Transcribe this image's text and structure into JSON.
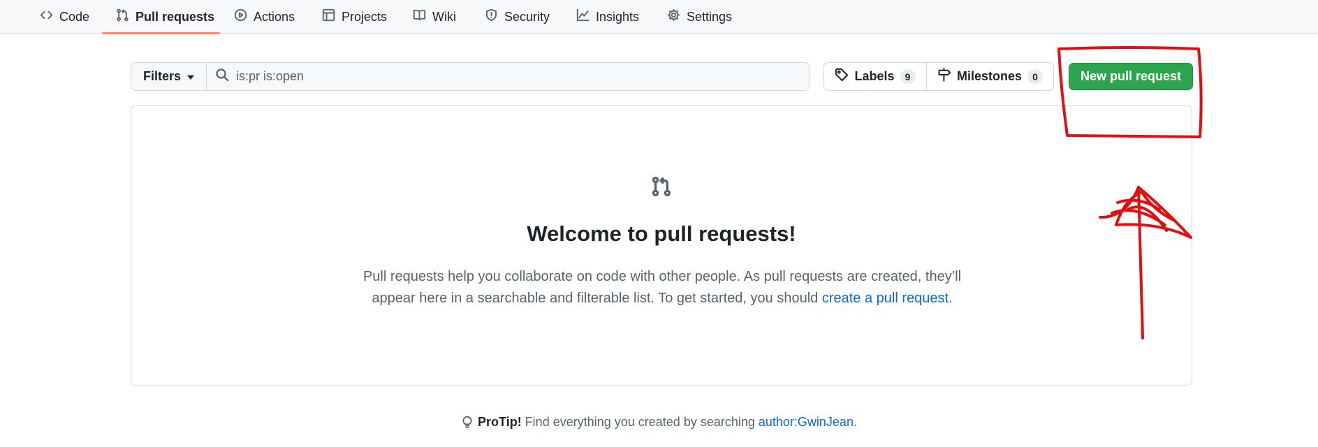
{
  "nav": {
    "items": [
      {
        "label": "Code",
        "icon": "code-icon"
      },
      {
        "label": "Pull requests",
        "icon": "git-pull-request-icon",
        "selected": true
      },
      {
        "label": "Actions",
        "icon": "play-circle-icon"
      },
      {
        "label": "Projects",
        "icon": "table-icon"
      },
      {
        "label": "Wiki",
        "icon": "book-icon"
      },
      {
        "label": "Security",
        "icon": "shield-icon"
      },
      {
        "label": "Insights",
        "icon": "graph-icon"
      },
      {
        "label": "Settings",
        "icon": "gear-icon"
      }
    ]
  },
  "toolbar": {
    "filters_label": "Filters",
    "search_value": "is:pr is:open",
    "labels_label": "Labels",
    "labels_count": "9",
    "milestones_label": "Milestones",
    "milestones_count": "0",
    "new_pr_label": "New pull request"
  },
  "blankslate": {
    "title": "Welcome to pull requests!",
    "text_before_link": "Pull requests help you collaborate on code with other people. As pull requests are created, they’ll appear here in a searchable and filterable list. To get started, you should ",
    "link_text": "create a pull request",
    "text_after_link": "."
  },
  "protip": {
    "label": "ProTip!",
    "text": " Find everything you created by searching ",
    "link_text": "author:GwinJean",
    "end": "."
  },
  "colors": {
    "accent_green": "#2da44e",
    "link_blue": "#0969da",
    "tab_underline": "#fd8c73",
    "annotation_red": "#e01010"
  }
}
